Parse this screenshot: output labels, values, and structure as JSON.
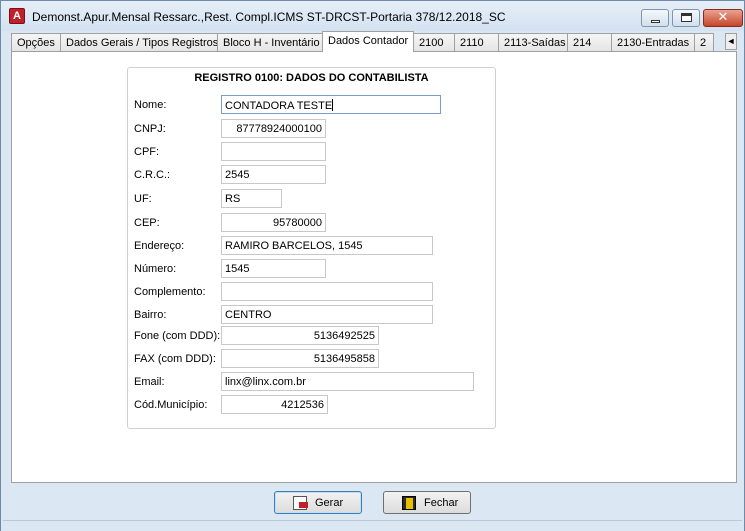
{
  "window": {
    "title": "Demonst.Apur.Mensal Ressarc.,Rest. Compl.ICMS ST-DRCST-Portaria 378/12.2018_SC",
    "app_icon_letter": "A"
  },
  "tabs": [
    {
      "label": "Opções"
    },
    {
      "label": "Dados Gerais / Tipos Registros"
    },
    {
      "label": "Bloco H - Inventário"
    },
    {
      "label": "Dados Contador",
      "active": true
    },
    {
      "label": "2100"
    },
    {
      "label": "2110"
    },
    {
      "label": "2113-Saídas"
    },
    {
      "label": "214"
    },
    {
      "label": "2130-Entradas"
    },
    {
      "label": "2"
    }
  ],
  "tab_scroll_glyph": "◄",
  "form": {
    "title": "REGISTRO 0100: DADOS DO CONTABILISTA",
    "fields": [
      {
        "label": "Nome:",
        "value": "CONTADORA TESTE"
      },
      {
        "label": "CNPJ:",
        "value": "87778924000100"
      },
      {
        "label": "CPF:",
        "value": ""
      },
      {
        "label": "C.R.C.:",
        "value": "2545"
      },
      {
        "label": "UF:",
        "value": "RS"
      },
      {
        "label": "CEP:",
        "value": "95780000"
      },
      {
        "label": "Endereço:",
        "value": "RAMIRO BARCELOS, 1545"
      },
      {
        "label": "Número:",
        "value": "1545"
      },
      {
        "label": "Complemento:",
        "value": ""
      },
      {
        "label": "Bairro:",
        "value": "CENTRO"
      },
      {
        "label": "Fone (com DDD):",
        "value": "5136492525"
      },
      {
        "label": "FAX (com DDD):",
        "value": "5136495858"
      },
      {
        "label": "Email:",
        "value": "linx@linx.com.br"
      },
      {
        "label": "Cód.Município:",
        "value": "4212536"
      }
    ]
  },
  "buttons": {
    "gerar": "Gerar",
    "fechar": "Fechar"
  },
  "icons": {
    "app": "app-logo-icon",
    "gerar": "generate-document-icon",
    "fechar": "exit-door-icon"
  }
}
